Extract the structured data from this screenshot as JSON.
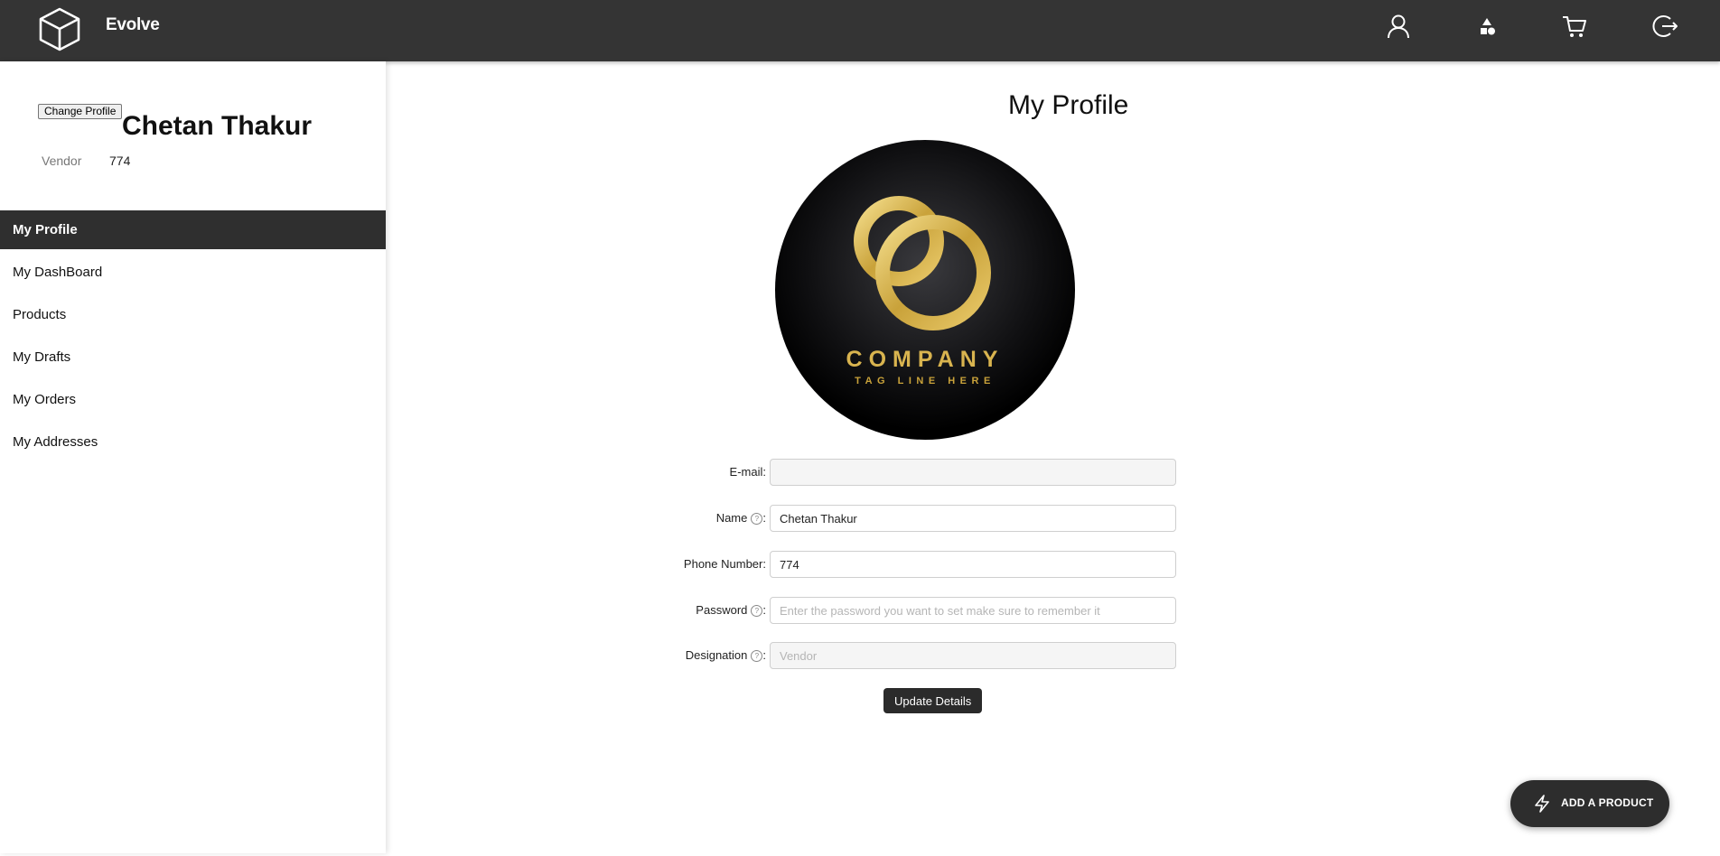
{
  "header": {
    "brand": "Evolve",
    "icons": [
      "box-logo-icon",
      "user-icon",
      "shapes-icon",
      "cart-icon",
      "logout-icon"
    ]
  },
  "sidebar": {
    "change_profile_label": "Change Profile",
    "user_name": "Chetan Thakur",
    "role": "Vendor",
    "phone": "774",
    "items": [
      {
        "label": "My Profile",
        "active": true
      },
      {
        "label": "My DashBoard"
      },
      {
        "label": "Products"
      },
      {
        "label": "My Drafts"
      },
      {
        "label": "My Orders"
      },
      {
        "label": "My Addresses"
      }
    ]
  },
  "main": {
    "title": "My Profile",
    "avatar": {
      "brand": "COMPANY",
      "tagline": "TAG LINE HERE"
    },
    "form": {
      "email": {
        "label": "E-mail",
        "value": ""
      },
      "name": {
        "label": "Name",
        "value": "Chetan Thakur"
      },
      "phone": {
        "label": "Phone Number",
        "value": "774"
      },
      "password": {
        "label": "Password",
        "value": "",
        "placeholder": "Enter the password you want to set make sure to remember it"
      },
      "designation": {
        "label": "Designation",
        "value": "",
        "placeholder": "Vendor"
      }
    },
    "update_label": "Update Details"
  },
  "fab": {
    "label": "ADD A PRODUCT"
  },
  "colors": {
    "topbar": "#343434",
    "active_menu": "#2f2f2f",
    "gold": "#d4b04a"
  }
}
